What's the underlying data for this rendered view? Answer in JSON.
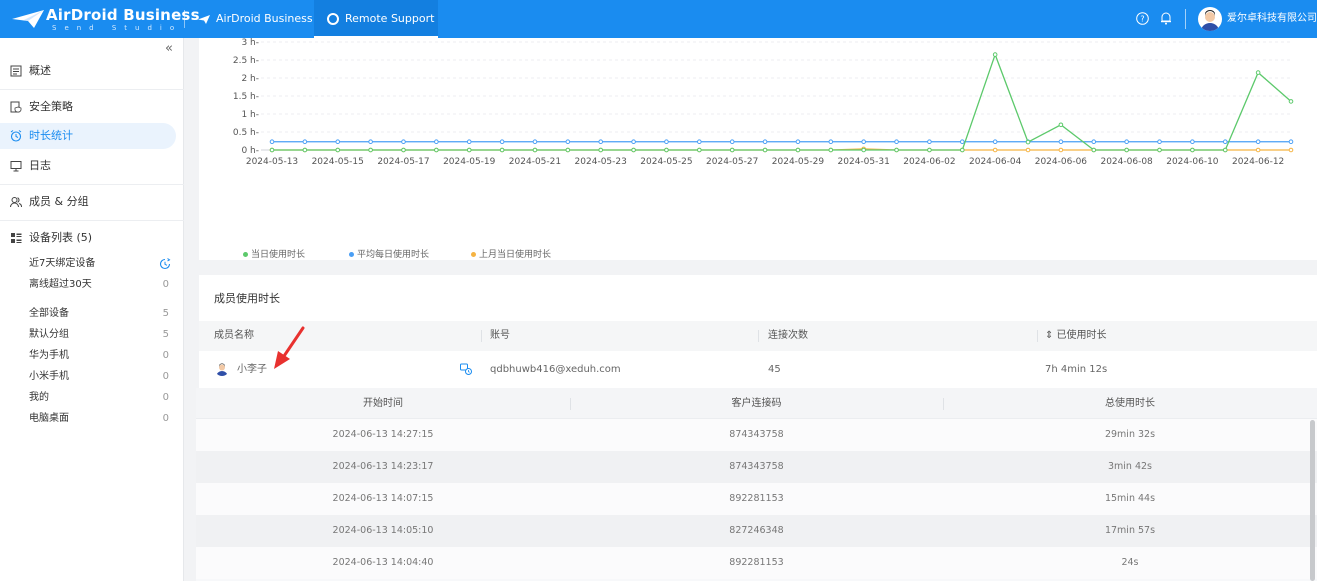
{
  "brand": {
    "name": "AirDroid Business",
    "sub": "Send Studio"
  },
  "header": {
    "tabs": [
      {
        "label": "AirDroid Business"
      },
      {
        "label": "Remote Support"
      }
    ],
    "company": "爱尔卓科技有限公司"
  },
  "sidebar": {
    "collapse": "«",
    "items": [
      {
        "label": "概述"
      },
      {
        "label": "安全策略"
      },
      {
        "label": "时长统计"
      },
      {
        "label": "日志"
      },
      {
        "label": "成员 & 分组"
      },
      {
        "label": "设备列表 (5)"
      }
    ],
    "sub_items": [
      {
        "label": "近7天绑定设备",
        "count": ""
      },
      {
        "label": "离线超过30天",
        "count": "0"
      },
      {
        "label": "全部设备",
        "count": "5"
      },
      {
        "label": "默认分组",
        "count": "5"
      },
      {
        "label": "华为手机",
        "count": "0"
      },
      {
        "label": "小米手机",
        "count": "0"
      },
      {
        "label": "我的",
        "count": "0"
      },
      {
        "label": "电脑桌面",
        "count": "0"
      }
    ]
  },
  "chart_data": {
    "type": "line",
    "y_ticks": [
      "0 h-",
      "0.5 h-",
      "1 h-",
      "1.5 h-",
      "2 h-",
      "2.5 h-",
      "3 h-"
    ],
    "ylim": [
      0,
      3
    ],
    "x_tick_labels": [
      "2024-05-13",
      "2024-05-15",
      "2024-05-17",
      "2024-05-19",
      "2024-05-21",
      "2024-05-23",
      "2024-05-25",
      "2024-05-27",
      "2024-05-29",
      "2024-05-31",
      "2024-06-02",
      "2024-06-04",
      "2024-06-06",
      "2024-06-08",
      "2024-06-10",
      "2024-06-12"
    ],
    "x": [
      "2024-05-13",
      "2024-05-14",
      "2024-05-15",
      "2024-05-16",
      "2024-05-17",
      "2024-05-18",
      "2024-05-19",
      "2024-05-20",
      "2024-05-21",
      "2024-05-22",
      "2024-05-23",
      "2024-05-24",
      "2024-05-25",
      "2024-05-26",
      "2024-05-27",
      "2024-05-28",
      "2024-05-29",
      "2024-05-30",
      "2024-05-31",
      "2024-06-01",
      "2024-06-02",
      "2024-06-03",
      "2024-06-04",
      "2024-06-05",
      "2024-06-06",
      "2024-06-07",
      "2024-06-08",
      "2024-06-09",
      "2024-06-10",
      "2024-06-11",
      "2024-06-12",
      "2024-06-13"
    ],
    "series": [
      {
        "name": "当日使用时长",
        "color": "#5cc96b",
        "values": [
          0,
          0,
          0,
          0,
          0,
          0,
          0,
          0,
          0,
          0,
          0,
          0,
          0,
          0,
          0,
          0,
          0,
          0,
          0,
          0,
          0,
          0,
          2.65,
          0.22,
          0.7,
          0,
          0,
          0,
          0,
          0,
          2.15,
          1.35
        ]
      },
      {
        "name": "平均每日使用时长",
        "color": "#4a9ff5",
        "values": [
          0.23,
          0.23,
          0.23,
          0.23,
          0.23,
          0.23,
          0.23,
          0.23,
          0.23,
          0.23,
          0.23,
          0.23,
          0.23,
          0.23,
          0.23,
          0.23,
          0.23,
          0.23,
          0.23,
          0.23,
          0.23,
          0.23,
          0.23,
          0.23,
          0.23,
          0.23,
          0.23,
          0.23,
          0.23,
          0.23,
          0.23,
          0.23
        ]
      },
      {
        "name": "上月当日使用时长",
        "color": "#f5b342",
        "values": [
          0,
          0,
          0,
          0,
          0,
          0,
          0,
          0,
          0,
          0,
          0,
          0,
          0,
          0,
          0,
          0,
          0,
          0,
          0.03,
          0,
          0,
          0,
          0,
          0,
          0,
          0,
          0,
          0,
          0,
          0,
          0,
          0
        ]
      }
    ]
  },
  "members": {
    "title": "成员使用时长",
    "columns": [
      "成员名称",
      "账号",
      "连接次数",
      "⇕ 已使用时长"
    ],
    "row": {
      "name": "小李子",
      "account": "qdbhuwb416@xeduh.com",
      "connections": "45",
      "duration": "7h 4min 12s"
    }
  },
  "sessions": {
    "columns": [
      "开始时间",
      "客户连接码",
      "总使用时长"
    ],
    "rows": [
      {
        "start": "2024-06-13 14:27:15",
        "code": "874343758",
        "total": "29min 32s"
      },
      {
        "start": "2024-06-13 14:23:17",
        "code": "874343758",
        "total": "3min 42s"
      },
      {
        "start": "2024-06-13 14:07:15",
        "code": "892281153",
        "total": "15min 44s"
      },
      {
        "start": "2024-06-13 14:05:10",
        "code": "827246348",
        "total": "17min 57s"
      },
      {
        "start": "2024-06-13 14:04:40",
        "code": "892281153",
        "total": "24s"
      }
    ]
  }
}
